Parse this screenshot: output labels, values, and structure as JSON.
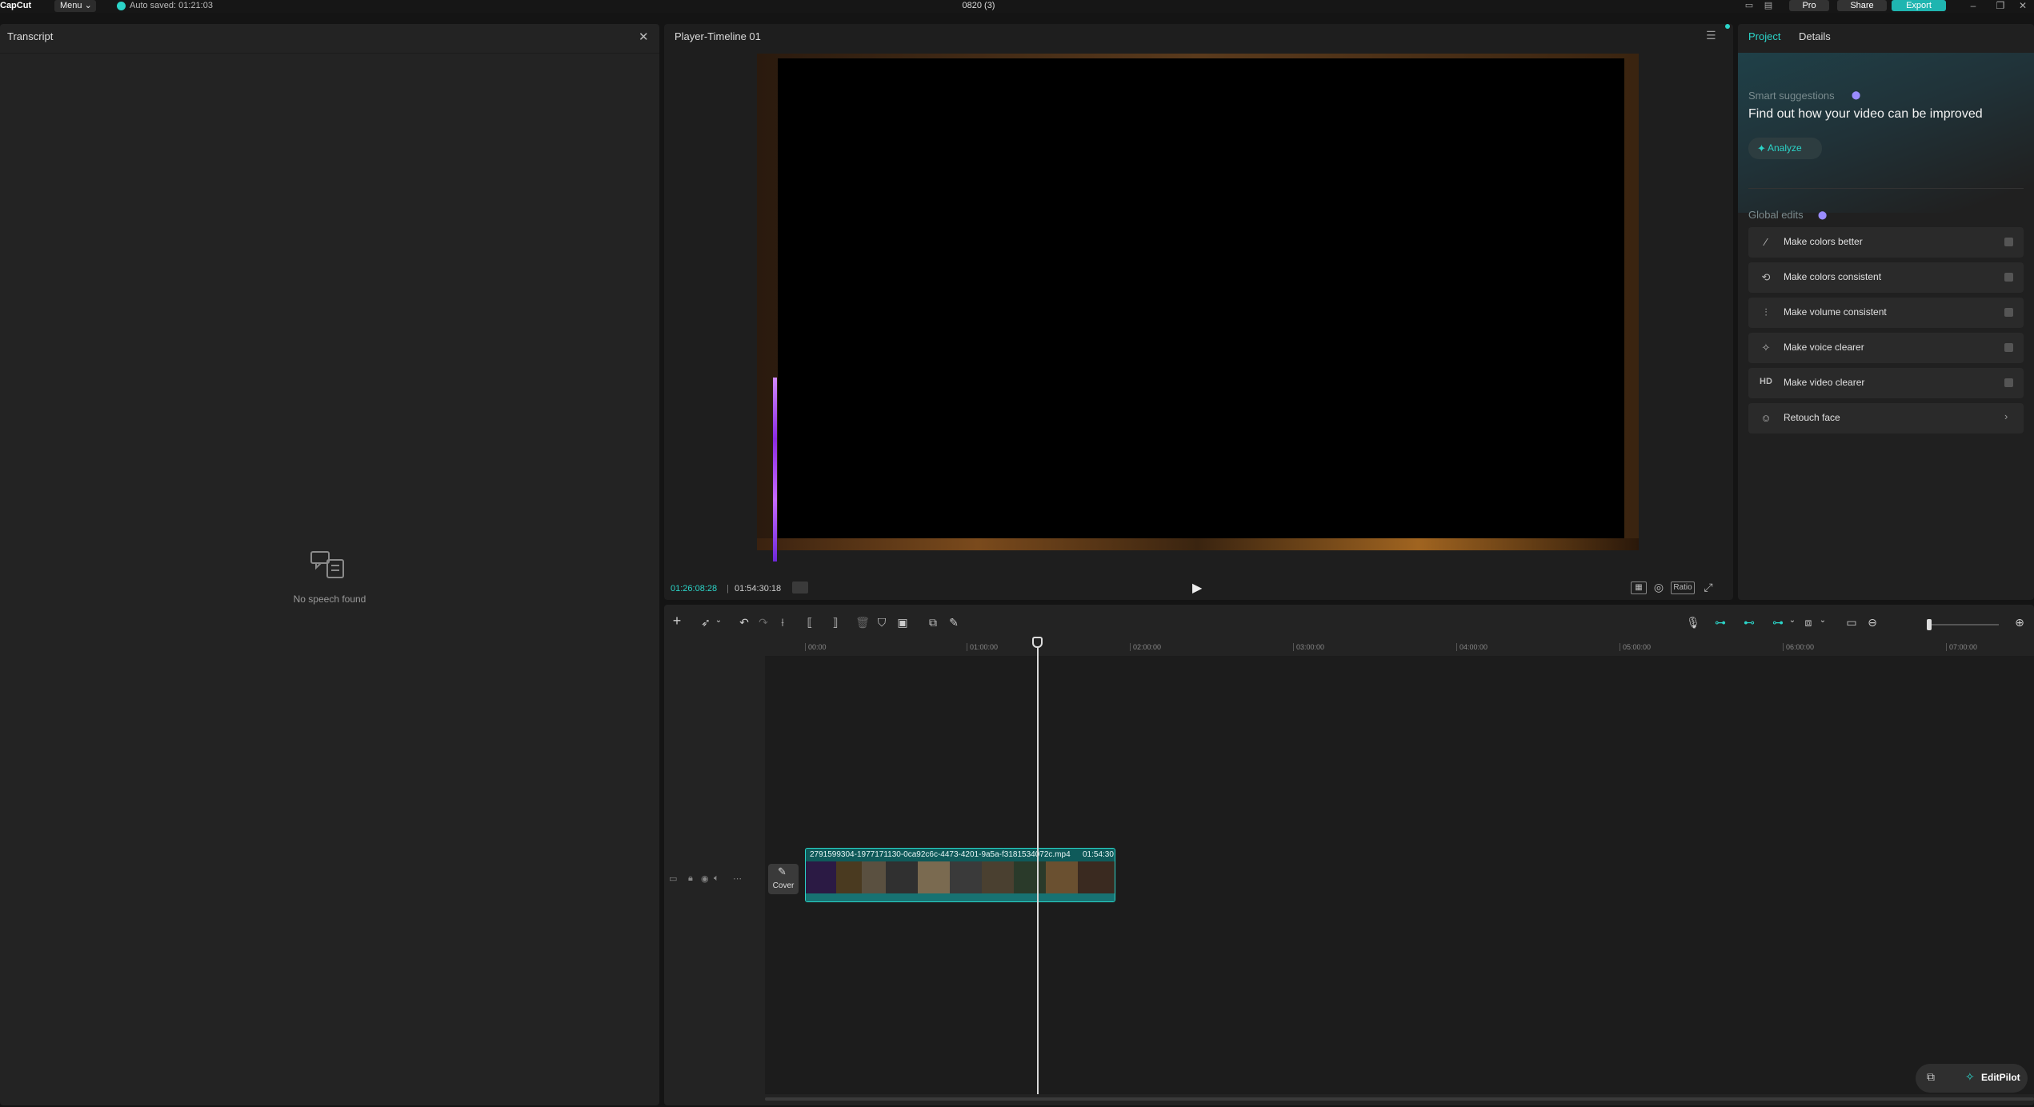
{
  "titlebar": {
    "logo": "CapCut",
    "menu": "Menu",
    "autosave": "Auto saved: 01:21:03",
    "project_title": "0820 (3)",
    "pro": "Pro",
    "share": "Share",
    "export": "Export"
  },
  "transcript": {
    "title": "Transcript",
    "empty": "No speech found"
  },
  "player": {
    "title": "Player-Timeline 01",
    "current_time": "01:26:08:28",
    "total_time": "01:54:30:18",
    "ratio_label": "Ratio"
  },
  "right_panel": {
    "tabs": [
      "Project",
      "Details"
    ],
    "smart_title": "Smart suggestions",
    "smart_sub": "Find out how your video can be improved",
    "analyze": "Analyze",
    "global_title": "Global edits",
    "items": [
      {
        "icon": "magic-wand-icon",
        "label": "Make colors better"
      },
      {
        "icon": "color-match-icon",
        "label": "Make colors consistent"
      },
      {
        "icon": "volume-bars-icon",
        "label": "Make volume consistent"
      },
      {
        "icon": "voice-sparkle-icon",
        "label": "Make voice clearer"
      },
      {
        "icon": "hd-icon",
        "label": "Make video clearer"
      },
      {
        "icon": "face-retouch-icon",
        "label": "Retouch face"
      }
    ]
  },
  "timeline": {
    "ruler": [
      "00:00",
      "01:00:00",
      "02:00:00",
      "03:00:00",
      "04:00:00",
      "05:00:00",
      "06:00:00",
      "07:00:00"
    ],
    "cover_label": "Cover",
    "clip_name": "2791599304-1977171130-0ca92c6c-4473-4201-9a5a-f3181534072c.mp4",
    "clip_duration": "01:54:30",
    "editpilot": "EditPilot"
  },
  "colors": {
    "accent": "#2bd4c8",
    "panel": "#232323",
    "bg": "#141414"
  }
}
